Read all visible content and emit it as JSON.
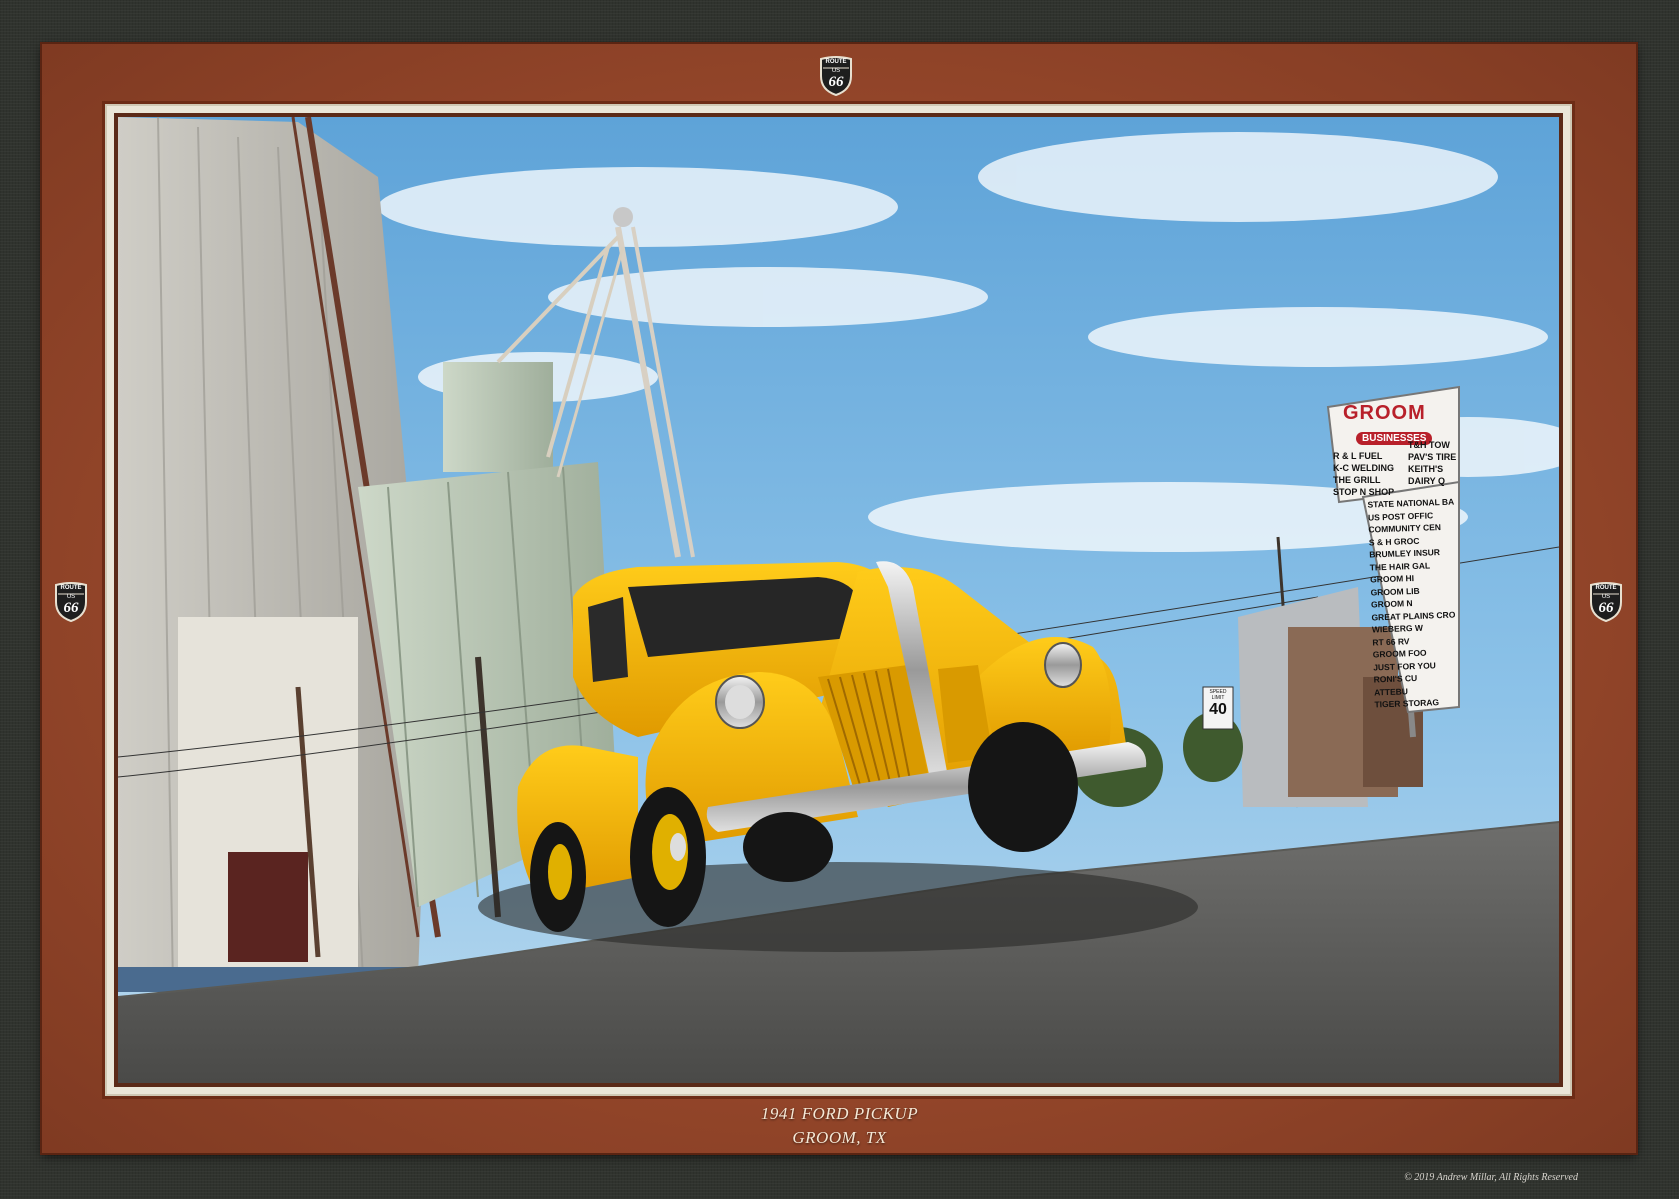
{
  "caption": {
    "line1": "1941 FORD PICKUP",
    "line2": "GROOM, TX"
  },
  "copyright": "© 2019 Andrew Millar, All Rights Reserved",
  "badge": {
    "top": "ROUTE",
    "middle": "US",
    "number": "66"
  },
  "sign": {
    "title": "GROOM",
    "subtitle": "BUSINESSES",
    "col1": [
      "R & L FUEL",
      "K-C WELDING",
      "THE GRILL",
      "STOP N SHOP"
    ],
    "col2": [
      "T&H TOW",
      "PAV'S TIRE",
      "KEITH'S",
      "DAIRY Q"
    ],
    "list": [
      "STATE NATIONAL BA",
      "US POST OFFIC",
      "COMMUNITY CEN",
      "S & H GROC",
      "BRUMLEY INSUR",
      "THE HAIR GAL",
      "GROOM HI",
      "GROOM LIB",
      "GROOM N",
      "GREAT PLAINS CRO",
      "WIEBERG W",
      "RT 66 RV",
      "GROOM FOO",
      "JUST FOR YOU",
      "RONI'S CU",
      "ATTEBU",
      "TIGER STORAG"
    ]
  },
  "speed_sign": {
    "label": "SPEED LIMIT",
    "value": "40"
  },
  "colors": {
    "leather": "#94462a",
    "mat": "#eae6d8",
    "truck": "#f5b800",
    "sky": "#7fb7e0"
  }
}
